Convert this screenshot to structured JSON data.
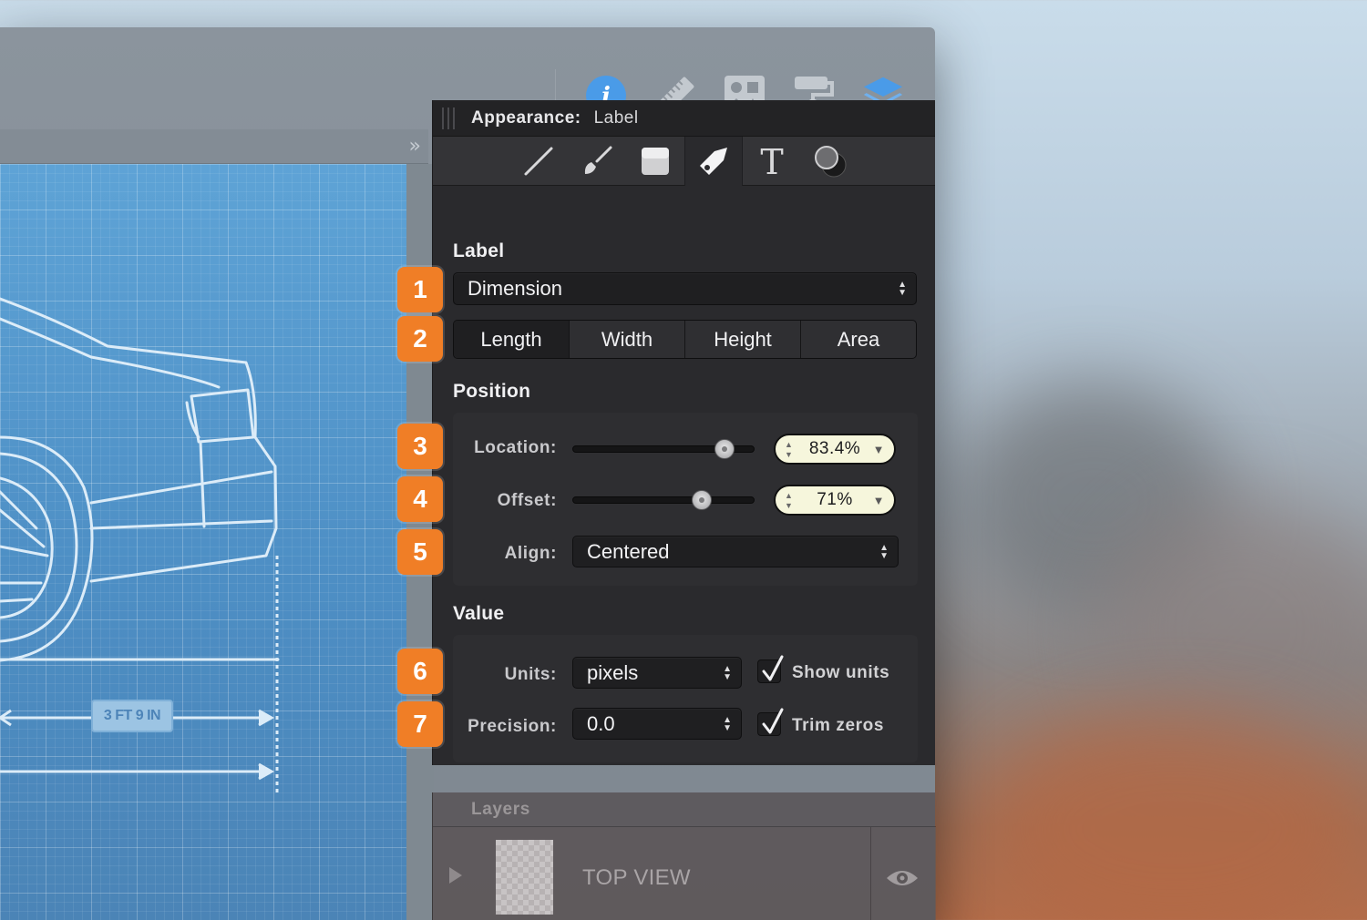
{
  "toolbar": {
    "icons": [
      "info-icon",
      "ruler-icon",
      "shapes-library-icon",
      "paint-roller-icon",
      "layers-icon"
    ]
  },
  "canvas": {
    "dimension_label": "3 FT 9 IN"
  },
  "inspector": {
    "header_title": "Appearance:",
    "header_value": "Label",
    "tool_tabs": [
      "line-tool-icon",
      "brush-tool-icon",
      "fill-tool-icon",
      "label-tag-icon",
      "text-tool-icon",
      "shadow-tool-icon"
    ],
    "label_section": {
      "title": "Label",
      "type_select": "Dimension",
      "segments": [
        "Length",
        "Width",
        "Height",
        "Area"
      ],
      "active_segment": "Length"
    },
    "position_section": {
      "title": "Position",
      "location_label": "Location:",
      "location_value": "83.4%",
      "location_fraction": 0.834,
      "offset_label": "Offset:",
      "offset_value": "71%",
      "offset_fraction": 0.71,
      "align_label": "Align:",
      "align_value": "Centered"
    },
    "value_section": {
      "title": "Value",
      "units_label": "Units:",
      "units_value": "pixels",
      "show_units_label": "Show units",
      "show_units_checked": true,
      "precision_label": "Precision:",
      "precision_value": "0.0",
      "trim_zeros_label": "Trim zeros",
      "trim_zeros_checked": true
    }
  },
  "badges": [
    "1",
    "2",
    "3",
    "4",
    "5",
    "6",
    "7"
  ],
  "layers": {
    "title": "Layers",
    "rows": [
      {
        "name": "TOP VIEW"
      }
    ]
  },
  "colors": {
    "badge": "#f07e26",
    "panel_bg": "#2a2a2d",
    "stepper_bg": "#f6f6dc",
    "accent_blue": "#4a9be8"
  }
}
